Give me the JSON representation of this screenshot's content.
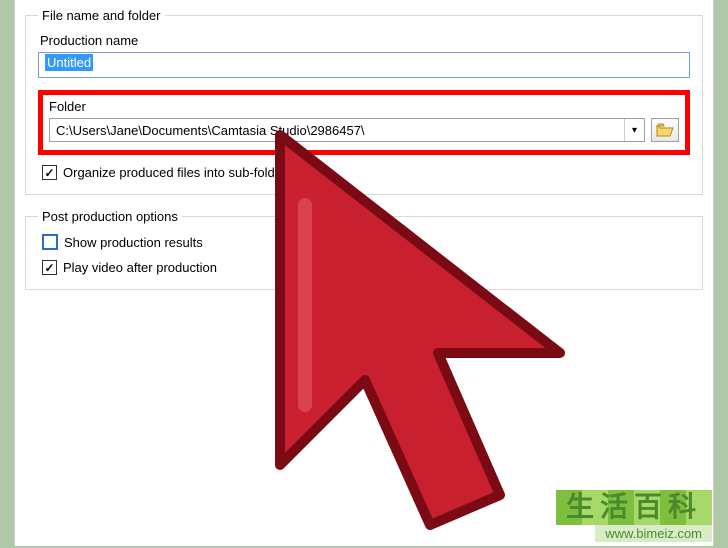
{
  "fieldset1": {
    "legend": "File name and folder",
    "production_label": "Production name",
    "production_value": "Untitled",
    "folder_label": "Folder",
    "folder_value": "C:\\Users\\Jane\\Documents\\Camtasia Studio\\2986457\\",
    "organize_label": "Organize produced files into sub-folders",
    "organize_checked": true
  },
  "fieldset2": {
    "legend": "Post production options",
    "show_results_label": "Show production results",
    "show_results_checked": false,
    "play_video_label": "Play video after production",
    "play_video_checked": true
  },
  "watermark": {
    "line1": "生活百科",
    "line2": "www.bimeiz.com"
  }
}
